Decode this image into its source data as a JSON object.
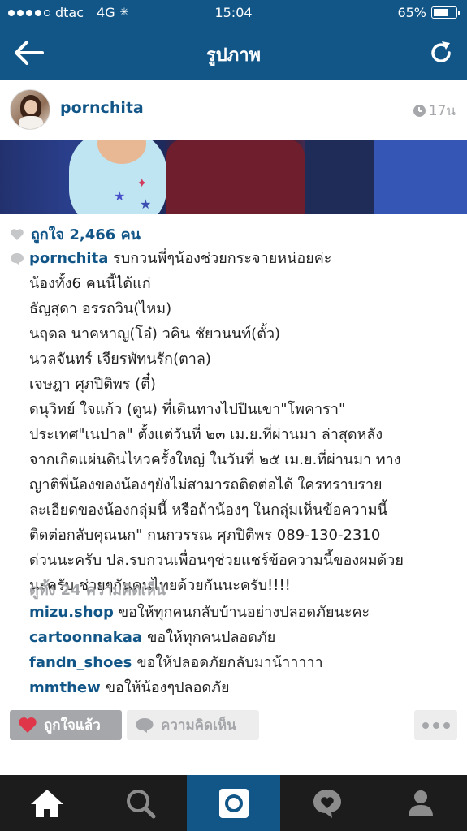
{
  "status_bar": {
    "carrier": "dtac",
    "network": "4G",
    "time": "15:04",
    "battery": "65%"
  },
  "nav": {
    "title": "รูปภาพ",
    "back_icon": "arrow-left-icon",
    "refresh_icon": "refresh-icon"
  },
  "post": {
    "username": "pornchita",
    "time_ago": "17น",
    "likes": "ถูกใจ 2,466 คน",
    "caption_user": "pornchita",
    "caption_lines": [
      "รบกวนพี่ๆน้องช่วยกระจายหน่อยค่ะ",
      " น้องทั้ง6 คนนี้ได้แก่",
      "ธัญสุดา อรรถวิน(ไหม)",
      "นฤดล นาคหาญ(โอ๋) วคิน ชัยวนนท์(ตั้ว)",
      "นวลจันทร์ เจียรพัทนรัก(ตาล)",
      "เจษฎา ศุภปิติพร (ตี๋)",
      "ดนุวิทย์ ใจแก้ว (ตูน)  ที่เดินทางไปปีนเขา\"โพคารา\"",
      "ประเทศ\"เนปาล\" ตั้งแต่วันที่ ๒๓ เม.ย.ที่ผ่านมา ล่าสุดหลัง",
      "จากเกิดแผ่นดินไหวครั้งใหญ่ ในวันที่ ๒๕ เม.ย.ที่ผ่านมา ทาง",
      "ญาติพี่น้องของน้องๆยังไม่สามารถติดต่อได้ ใครทราบราย",
      "ละเอียดของน้องกลุ่มนี้ หรือถ้าน้องๆ ในกลุ่มเห็นข้อความนี้",
      "ติดต่อกลับคุณนก\" กนกวรรณ ศุภปิติพร 089-130-2310",
      "ด่วนนะครับ  ปล.รบกวนเพื่อนๆช่วยแชร์ข้อความนี้ของผมด้วย",
      "นะครับ ช่วยๆกันคนไทยด้วยกันนะครับ!!!!"
    ],
    "view_all_comments": "ดูทั้ง 24 ความคิดเห็น",
    "comments": [
      {
        "user": "mizu.shop",
        "text": "ขอให้ทุกคนกลับบ้านอย่างปลอดภัยนะคะ"
      },
      {
        "user": "cartoonnakaa",
        "text": "ขอให้ทุกคนปลอดภัย"
      },
      {
        "user": "fandn_shoes",
        "text": "ขอให้ปลอดภัยกลับมาน้าาาาา"
      },
      {
        "user": "mmthew",
        "text": "ขอให้น้องๆปลอดภัย"
      }
    ]
  },
  "actions": {
    "liked_label": "ถูกใจแล้ว",
    "comment_label": "ความคิดเห็น"
  },
  "tabbar": {
    "items": [
      "home-icon",
      "search-icon",
      "camera-icon",
      "activity-icon",
      "profile-icon"
    ],
    "active": "camera-icon"
  },
  "colors": {
    "brand": "#125688",
    "like_red": "#e0364a",
    "gray": "#a5a7aa",
    "tabbar_bg": "#1c1c1c"
  }
}
